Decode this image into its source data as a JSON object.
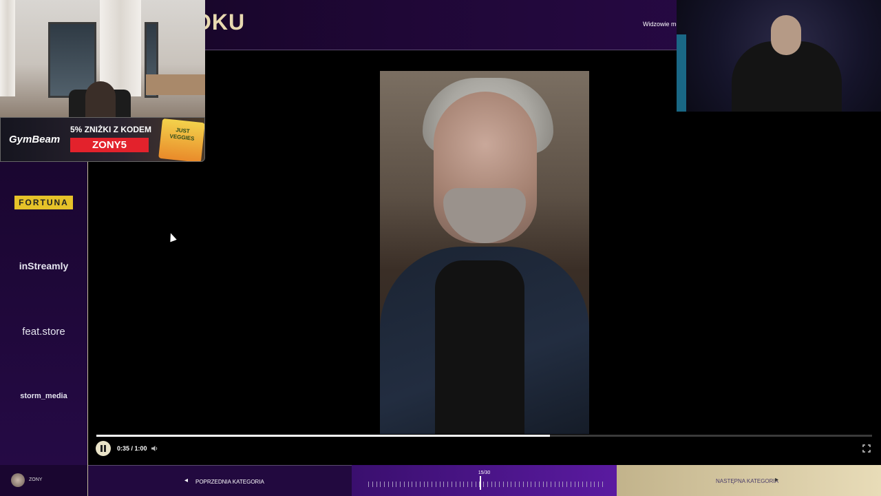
{
  "header": {
    "title": "OKU",
    "note": "Widzowie mog"
  },
  "ad": {
    "brand": "GymBeam",
    "promo": "5% ZNIŻKI Z KODEM",
    "code": "ZONY5",
    "product_lines": [
      "JUST",
      "VEGGIES"
    ]
  },
  "sponsors": {
    "fortuna": "FORTUNA",
    "instreamly": "inStreamly",
    "featstore": "feat.store",
    "storm": "storm_media"
  },
  "player": {
    "time": "0:35 / 1:00",
    "progress": 0.585,
    "state": "playing"
  },
  "bottombar": {
    "user_name": "ZONY",
    "prev_label": "POPRZEDNIA KATEGORIA",
    "next_label": "NASTĘPNA KATEGORIA",
    "counter": "15/30",
    "current": 15,
    "total": 30
  },
  "colors": {
    "accent_gold": "#e8d9b0",
    "purple": "#5a1aa0",
    "ad_red": "#e3222c"
  },
  "icons": [
    "pause-icon",
    "volume-icon",
    "fullscreen-icon",
    "arrow-left-icon",
    "arrow-right-icon"
  ]
}
